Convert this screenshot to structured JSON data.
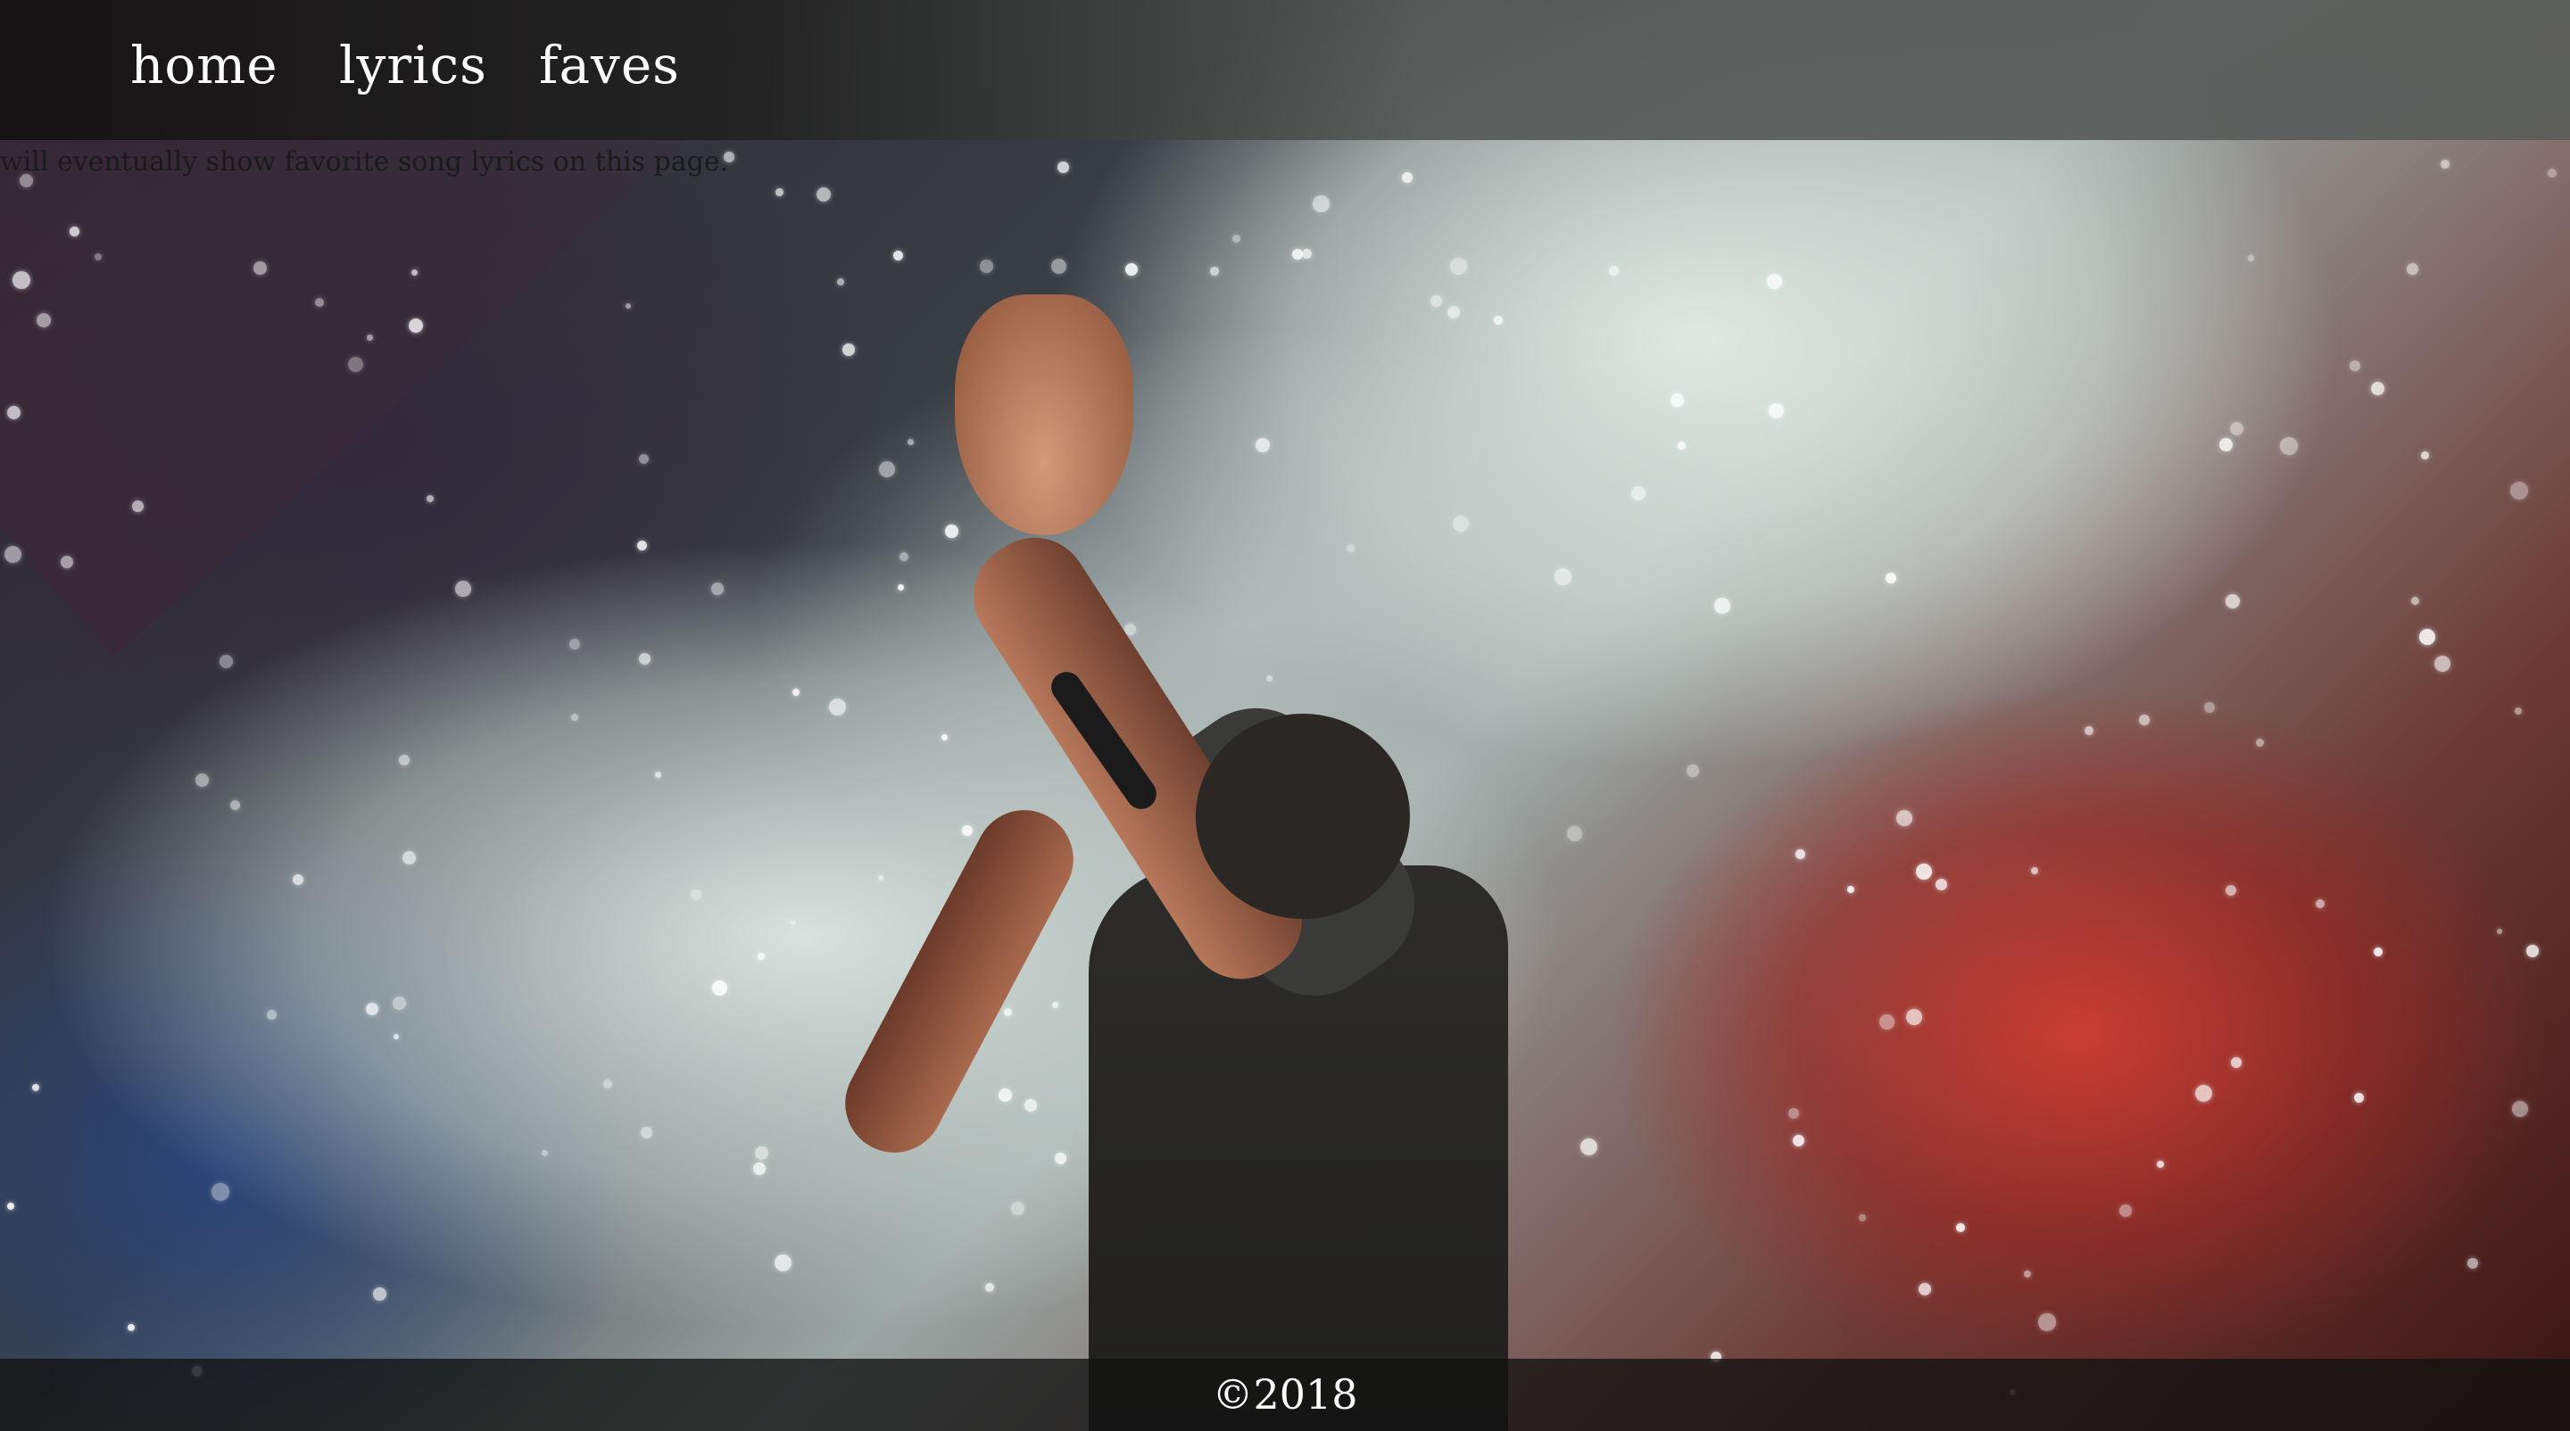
{
  "nav": {
    "items": [
      {
        "label": "home"
      },
      {
        "label": "lyrics"
      },
      {
        "label": "faves"
      }
    ]
  },
  "main": {
    "intro_text": "will eventually show favorite song lyrics on this page."
  },
  "footer": {
    "copyright": "©2018"
  },
  "background": {
    "image_subject": "concert-performer-raised-hand-smoke-photo",
    "accent_colors": [
      "#c93b33",
      "#e6eee9",
      "#2a3f7a"
    ]
  }
}
